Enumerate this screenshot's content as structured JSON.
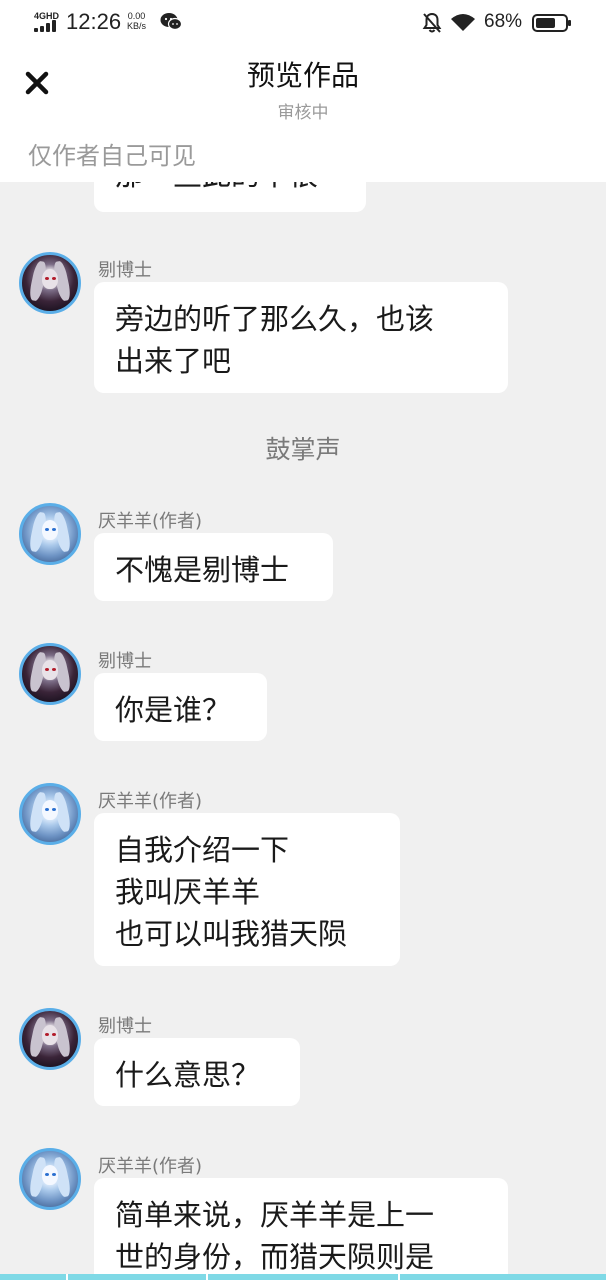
{
  "status_bar": {
    "network": "4GHD",
    "time": "12:26",
    "speed_value": "0.00",
    "speed_unit": "KB/s",
    "battery": "68%",
    "battery_level": 0.68
  },
  "header": {
    "close_icon": "close-icon",
    "title": "预览作品",
    "subtitle": "审核中",
    "visibility_note": "仅作者自己可见"
  },
  "chat": {
    "partial_top_text": "那一些此的华很",
    "messages": [
      {
        "sender": "剔博士",
        "avatar": "dark-haired-character-avatar",
        "text": "旁边的听了那么久，也该\n出来了吧"
      },
      {
        "system": "鼓掌声"
      },
      {
        "sender": "厌羊羊(作者)",
        "avatar": "blue-character-avatar",
        "text": "不愧是剔博士"
      },
      {
        "sender": "剔博士",
        "avatar": "dark-haired-character-avatar",
        "text": "你是谁？"
      },
      {
        "sender": "厌羊羊(作者)",
        "avatar": "blue-character-avatar",
        "text": "自我介绍一下\n我叫厌羊羊\n也可以叫我猎天陨"
      },
      {
        "sender": "剔博士",
        "avatar": "dark-haired-character-avatar",
        "text": "什么意思？"
      },
      {
        "sender": "厌羊羊(作者)",
        "avatar": "blue-character-avatar",
        "text": "简单来说，厌羊羊是上一\n世的身份，而猎天陨则是"
      }
    ]
  },
  "colors": {
    "avatar_ring": "#5aaee8",
    "bottom_strip": "#7fd9e6",
    "background": "#f0f0f0"
  }
}
